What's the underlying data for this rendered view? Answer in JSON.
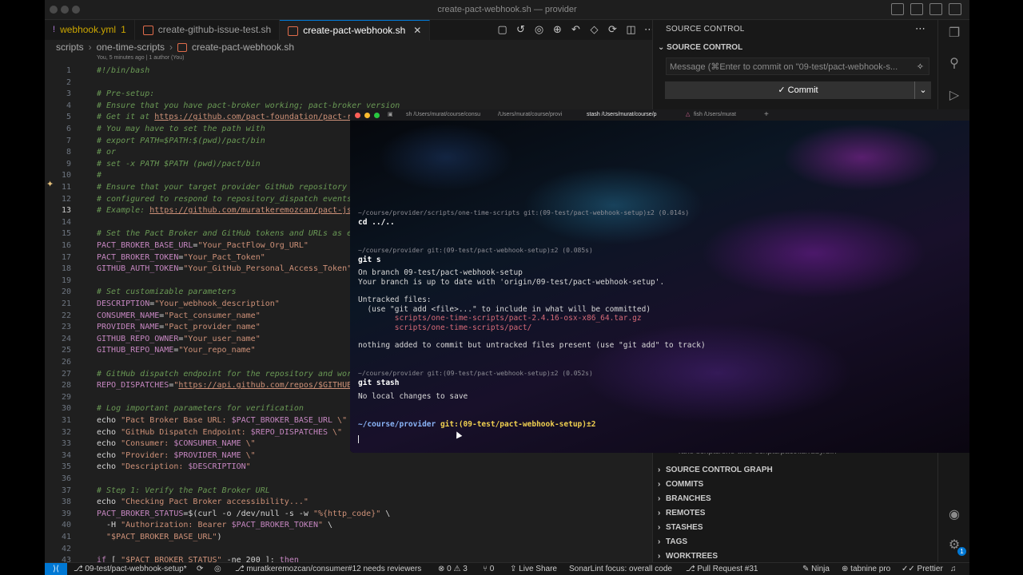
{
  "window": {
    "title": "create-pact-webhook.sh — provider"
  },
  "tabs": [
    {
      "label": "webhook.yml",
      "badge": "1"
    },
    {
      "label": "create-github-issue-test.sh"
    },
    {
      "label": "create-pact-webhook.sh",
      "close": "✕"
    }
  ],
  "breadcrumb": [
    "scripts",
    "one-time-scripts",
    "create-pact-webhook.sh"
  ],
  "blame": "You, 5 minutes ago | 1 author (You)",
  "editor": {
    "lines": [
      {
        "n": "1",
        "parts": [
          {
            "c": "c",
            "t": "#!/bin/bash"
          }
        ]
      },
      {
        "n": "2",
        "parts": []
      },
      {
        "n": "3",
        "parts": [
          {
            "c": "c",
            "t": "# Pre-setup:"
          }
        ]
      },
      {
        "n": "4",
        "parts": [
          {
            "c": "c",
            "t": "# Ensure that you have pact-broker working; pact-broker version"
          }
        ]
      },
      {
        "n": "5",
        "parts": [
          {
            "c": "c",
            "t": "# Get it at "
          },
          {
            "c": "u",
            "t": "https://github.com/pact-foundation/pact-ru"
          }
        ]
      },
      {
        "n": "6",
        "parts": [
          {
            "c": "c",
            "t": "# You may have to set the path with"
          }
        ]
      },
      {
        "n": "7",
        "parts": [
          {
            "c": "c",
            "t": "# export PATH=$PATH:$(pwd)/pact/bin"
          }
        ]
      },
      {
        "n": "8",
        "parts": [
          {
            "c": "c",
            "t": "# or"
          }
        ]
      },
      {
        "n": "9",
        "parts": [
          {
            "c": "c",
            "t": "# set -x PATH $PATH (pwd)/pact/bin"
          }
        ]
      },
      {
        "n": "10",
        "parts": [
          {
            "c": "c",
            "t": "#"
          }
        ]
      },
      {
        "n": "11",
        "parts": [
          {
            "c": "c",
            "t": "# Ensure that your target provider GitHub repository i"
          }
        ]
      },
      {
        "n": "12",
        "parts": [
          {
            "c": "c",
            "t": "# configured to respond to repository_dispatch events"
          }
        ]
      },
      {
        "n": "13",
        "parts": [
          {
            "c": "c",
            "t": "# Example: "
          },
          {
            "c": "u",
            "t": "https://github.com/muratkeremozcan/pact-js-"
          }
        ]
      },
      {
        "n": "14",
        "parts": []
      },
      {
        "n": "15",
        "parts": [
          {
            "c": "c",
            "t": "# Set the Pact Broker and GitHub tokens and URLs as en"
          }
        ]
      },
      {
        "n": "16",
        "parts": [
          {
            "c": "kw",
            "t": "PACT_BROKER_BASE_URL"
          },
          {
            "c": "p",
            "t": "="
          },
          {
            "c": "v",
            "t": "\"Your_PactFlow_Org_URL\""
          }
        ]
      },
      {
        "n": "17",
        "parts": [
          {
            "c": "kw",
            "t": "PACT_BROKER_TOKEN"
          },
          {
            "c": "p",
            "t": "="
          },
          {
            "c": "v",
            "t": "\"Your_Pact_Token\""
          }
        ]
      },
      {
        "n": "18",
        "parts": [
          {
            "c": "kw",
            "t": "GITHUB_AUTH_TOKEN"
          },
          {
            "c": "p",
            "t": "="
          },
          {
            "c": "v",
            "t": "\"Your_GitHub_Personal_Access_Token\""
          }
        ]
      },
      {
        "n": "19",
        "parts": []
      },
      {
        "n": "20",
        "parts": [
          {
            "c": "c",
            "t": "# Set customizable parameters"
          }
        ]
      },
      {
        "n": "21",
        "parts": [
          {
            "c": "kw",
            "t": "DESCRIPTION"
          },
          {
            "c": "p",
            "t": "="
          },
          {
            "c": "v",
            "t": "\"Your_webhook_description\""
          }
        ]
      },
      {
        "n": "22",
        "parts": [
          {
            "c": "kw",
            "t": "CONSUMER_NAME"
          },
          {
            "c": "p",
            "t": "="
          },
          {
            "c": "v",
            "t": "\"Pact_consumer_name\""
          }
        ]
      },
      {
        "n": "23",
        "parts": [
          {
            "c": "kw",
            "t": "PROVIDER_NAME"
          },
          {
            "c": "p",
            "t": "="
          },
          {
            "c": "v",
            "t": "\"Pact_provider_name\""
          }
        ]
      },
      {
        "n": "24",
        "parts": [
          {
            "c": "kw",
            "t": "GITHUB_REPO_OWNER"
          },
          {
            "c": "p",
            "t": "="
          },
          {
            "c": "v",
            "t": "\"Your_user_name\""
          }
        ]
      },
      {
        "n": "25",
        "parts": [
          {
            "c": "kw",
            "t": "GITHUB_REPO_NAME"
          },
          {
            "c": "p",
            "t": "="
          },
          {
            "c": "v",
            "t": "\"Your_repo_name\""
          }
        ]
      },
      {
        "n": "26",
        "parts": []
      },
      {
        "n": "27",
        "parts": [
          {
            "c": "c",
            "t": "# GitHub dispatch endpoint for the repository and work"
          }
        ]
      },
      {
        "n": "28",
        "parts": [
          {
            "c": "kw",
            "t": "REPO_DISPATCHES"
          },
          {
            "c": "p",
            "t": "="
          },
          {
            "c": "v",
            "t": "\""
          },
          {
            "c": "u",
            "t": "https://api.github.com/repos/$GITHUB_"
          }
        ]
      },
      {
        "n": "29",
        "parts": []
      },
      {
        "n": "30",
        "parts": [
          {
            "c": "c",
            "t": "# Log important parameters for verification"
          }
        ]
      },
      {
        "n": "31",
        "parts": [
          {
            "c": "p",
            "t": "echo "
          },
          {
            "c": "v",
            "t": "\"Pact Broker Base URL: "
          },
          {
            "c": "kw",
            "t": "$PACT_BROKER_BASE_URL"
          },
          {
            "c": "v",
            "t": " \\\""
          }
        ]
      },
      {
        "n": "32",
        "parts": [
          {
            "c": "p",
            "t": "echo "
          },
          {
            "c": "v",
            "t": "\"GitHub Dispatch Endpoint: "
          },
          {
            "c": "kw",
            "t": "$REPO_DISPATCHES"
          },
          {
            "c": "v",
            "t": " \\\""
          }
        ]
      },
      {
        "n": "33",
        "parts": [
          {
            "c": "p",
            "t": "echo "
          },
          {
            "c": "v",
            "t": "\"Consumer: "
          },
          {
            "c": "kw",
            "t": "$CONSUMER_NAME"
          },
          {
            "c": "v",
            "t": " \\\""
          }
        ]
      },
      {
        "n": "34",
        "parts": [
          {
            "c": "p",
            "t": "echo "
          },
          {
            "c": "v",
            "t": "\"Provider: "
          },
          {
            "c": "kw",
            "t": "$PROVIDER_NAME"
          },
          {
            "c": "v",
            "t": " \\\""
          }
        ]
      },
      {
        "n": "35",
        "parts": [
          {
            "c": "p",
            "t": "echo "
          },
          {
            "c": "v",
            "t": "\"Description: "
          },
          {
            "c": "kw",
            "t": "$DESCRIPTION"
          },
          {
            "c": "v",
            "t": "\""
          }
        ]
      },
      {
        "n": "36",
        "parts": []
      },
      {
        "n": "37",
        "parts": [
          {
            "c": "c",
            "t": "# Step 1: Verify the Pact Broker URL"
          }
        ]
      },
      {
        "n": "38",
        "parts": [
          {
            "c": "p",
            "t": "echo "
          },
          {
            "c": "v",
            "t": "\"Checking Pact Broker accessibility...\""
          }
        ]
      },
      {
        "n": "39",
        "parts": [
          {
            "c": "kw",
            "t": "PACT_BROKER_STATUS"
          },
          {
            "c": "p",
            "t": "=$(curl -o /dev/null -s -w "
          },
          {
            "c": "v",
            "t": "\"%{http_code}\""
          },
          {
            "c": "p",
            "t": " \\"
          }
        ]
      },
      {
        "n": "40",
        "parts": [
          {
            "c": "p",
            "t": "  -H "
          },
          {
            "c": "v",
            "t": "\"Authorization: Bearer "
          },
          {
            "c": "kw",
            "t": "$PACT_BROKER_TOKEN"
          },
          {
            "c": "v",
            "t": "\""
          },
          {
            "c": "p",
            "t": " \\"
          }
        ]
      },
      {
        "n": "41",
        "parts": [
          {
            "c": "v",
            "t": "  \"$PACT_BROKER_BASE_URL\""
          },
          {
            "c": "p",
            "t": ")"
          }
        ]
      },
      {
        "n": "42",
        "parts": []
      },
      {
        "n": "43",
        "parts": [
          {
            "c": "kw",
            "t": "if"
          },
          {
            "c": "p",
            "t": " [ "
          },
          {
            "c": "v",
            "t": "\"$PACT_BROKER_STATUS\""
          },
          {
            "c": "p",
            "t": " -ne 200 ]; "
          },
          {
            "c": "kw",
            "t": "then"
          }
        ]
      }
    ]
  },
  "scm": {
    "header": "SOURCE CONTROL",
    "section": "SOURCE CONTROL",
    "commit_placeholder": "Message (⌘Enter to commit on \"09-test/pact-webhook-s...",
    "commit_label": "✓ Commit",
    "take_row": "Take  scripts/one-time-scripts/pact/lib/ruby/bin",
    "groups": [
      "SOURCE CONTROL GRAPH",
      "COMMITS",
      "BRANCHES",
      "REMOTES",
      "STASHES",
      "TAGS",
      "WORKTREES"
    ]
  },
  "terminal": {
    "tabs": [
      "sh /Users/murat/course/consu",
      "/Users/murat/course/provi",
      "stash /Users/murat/course/p",
      "fish /Users/murat"
    ],
    "new_tab": "+",
    "lines": [
      {
        "cls": "dim",
        "t": "~/course/provider/scripts/one-time-scripts git:(09-test/pact-webhook-setup)±2 (0.014s)"
      },
      {
        "cls": "cmd",
        "t": "cd ../.."
      },
      {
        "cls": "dim",
        "t": "~/course/provider git:(09-test/pact-webhook-setup)±2 (0.085s)"
      },
      {
        "cls": "cmd",
        "t": "git s"
      },
      {
        "cls": "",
        "t": "On branch 09-test/pact-webhook-setup"
      },
      {
        "cls": "",
        "t": "Your branch is up to date with 'origin/09-test/pact-webhook-setup'."
      },
      {
        "cls": "",
        "t": "Untracked files:"
      },
      {
        "cls": "",
        "t": "  (use \"git add <file>...\" to include in what will be committed)"
      },
      {
        "cls": "red",
        "t": "        scripts/one-time-scripts/pact-2.4.16-osx-x86_64.tar.gz"
      },
      {
        "cls": "red",
        "t": "        scripts/one-time-scripts/pact/"
      },
      {
        "cls": "",
        "t": "nothing added to commit but untracked files present (use \"git add\" to track)"
      },
      {
        "cls": "dim",
        "t": "~/course/provider git:(09-test/pact-webhook-setup)±2 (0.052s)"
      },
      {
        "cls": "cmd",
        "t": "git stash"
      },
      {
        "cls": "",
        "t": "No local changes to save"
      }
    ],
    "prompt_path": "~/course/provider",
    "prompt_branch": " git:(09-test/pact-webhook-setup)±2"
  },
  "statusbar": {
    "branch": "09-test/pact-webhook-setup*",
    "pr_ref": "muratkeremozcan/consumer#12 needs reviewers",
    "problems": "⊗ 0 ⚠ 3",
    "ports": "⑂ 0",
    "live_share": "Live Share",
    "sonarlint": "SonarLint focus: overall code",
    "pull_request": "Pull Request #31",
    "ninja": "Ninja",
    "tabnine": "tabnine pro",
    "prettier": "✓✓ Prettier"
  },
  "activity_badge": "1"
}
